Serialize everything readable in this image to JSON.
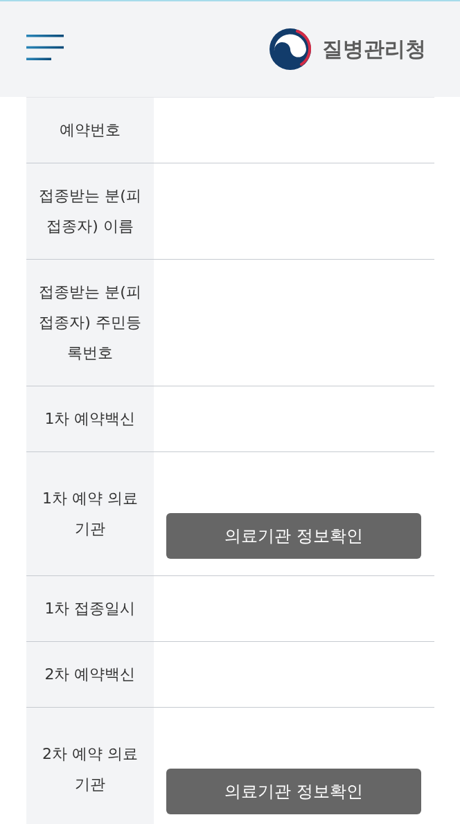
{
  "header": {
    "title": "질병관리청"
  },
  "rows": [
    {
      "label": "예약번호",
      "kind": "plain"
    },
    {
      "label": "접종받는 분(피접종자) 이름",
      "kind": "plain"
    },
    {
      "label": "접종받는 분(피접종자) 주민등록번호",
      "kind": "plain"
    },
    {
      "label": "1차 예약백신",
      "kind": "plain"
    },
    {
      "label": "1차 예약 의료기관",
      "kind": "button",
      "button": "의료기관 정보확인"
    },
    {
      "label": "1차 접종일시",
      "kind": "plain"
    },
    {
      "label": "2차 예약백신",
      "kind": "plain"
    },
    {
      "label": "2차 예약 의료기관",
      "kind": "button",
      "button": "의료기관 정보확인"
    }
  ]
}
